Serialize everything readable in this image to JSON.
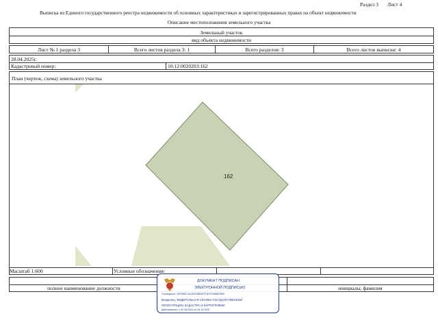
{
  "header": {
    "section": "Раздел 3",
    "sheet": "Лист 4",
    "title": "Выписка из Единого государственного реестра недвижимости об основных характеристиках и зарегистрированных правах на объект недвижимости",
    "subtitle": "Описание местоположения земельного участка"
  },
  "object": {
    "type": "Земельный участок",
    "type_caption": "вид объекта недвижимости"
  },
  "sheets": {
    "sheet_no": "Лист № 1 раздела 3",
    "total_in_section": "Всего листов раздела 3: 1",
    "total_sections": "Всего разделов: 3",
    "total_sheets": "Всего листов выписки: 4"
  },
  "date": "28.04.2025г.",
  "cadastral": {
    "label": "Кадастровый номер:",
    "value": "10:12:0020203:162"
  },
  "plan": {
    "title": "План (чертеж, схема) земельного участка",
    "parcel_label": "162",
    "parcel_color": "#c7d3b3",
    "neighbor_color": "#dfe7c8"
  },
  "footer": {
    "scale": "Масштаб 1:600",
    "legend_label": "Условные обозначения:",
    "position_caption": "полное наименование должности",
    "name_caption": "инициалы, фамилия"
  },
  "signature": {
    "line1": "ДОКУМЕНТ ПОДПИСАН",
    "line2": "ЭЛЕКТРОННОЙ ПОДПИСЬЮ",
    "certificate": "Сертификат: 00F9BDC161A023B6497F1E237968B7B00",
    "owner_line1": "Владелец: ФЕДЕРАЛЬНАЯ СЛУЖБА ГОСУДАРСТВЕННОЙ",
    "owner_line2": "РЕГИСТРАЦИИ, КАДАСТРА И КАРТОГРАФИИ",
    "valid": "Действителен: с 02.08.2024 по 26.10.2025",
    "border_color": "#1f3a8c"
  }
}
